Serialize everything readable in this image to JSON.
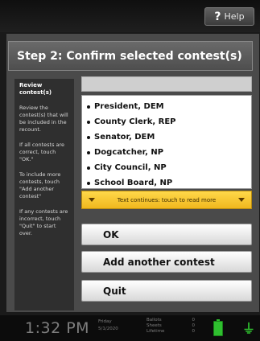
{
  "help": {
    "icon": "?",
    "label": "Help"
  },
  "header": {
    "title": "Step 2: Confirm selected contest(s)"
  },
  "sidebar": {
    "title": "Review contest(s)",
    "paragraphs": [
      "Review the contest(s) that will be included in the recount.",
      "If all contests are correct, touch \"OK.\"",
      "To include more contests, touch \"Add another contest\"",
      "If any contests are incorrect, touch \"Quit\" to start over."
    ]
  },
  "contests": [
    "President, DEM",
    "County Clerk, REP",
    "Senator, DEM",
    "Dogcatcher, NP",
    "City Council, NP",
    "School Board, NP"
  ],
  "continue_text": "Text continues: touch to read more",
  "buttons": {
    "ok": "OK",
    "add": "Add another contest",
    "quit": "Quit"
  },
  "status": {
    "time": "1:32 PM",
    "day": "Friday",
    "date": "5/1/2020",
    "counts": [
      {
        "label": "Ballots",
        "value": "0"
      },
      {
        "label": "Sheets",
        "value": "0"
      },
      {
        "label": "Lifetime",
        "value": "0"
      }
    ]
  },
  "colors": {
    "accent_yellow": "#f0b81e",
    "battery_green": "#2fbf2f"
  }
}
